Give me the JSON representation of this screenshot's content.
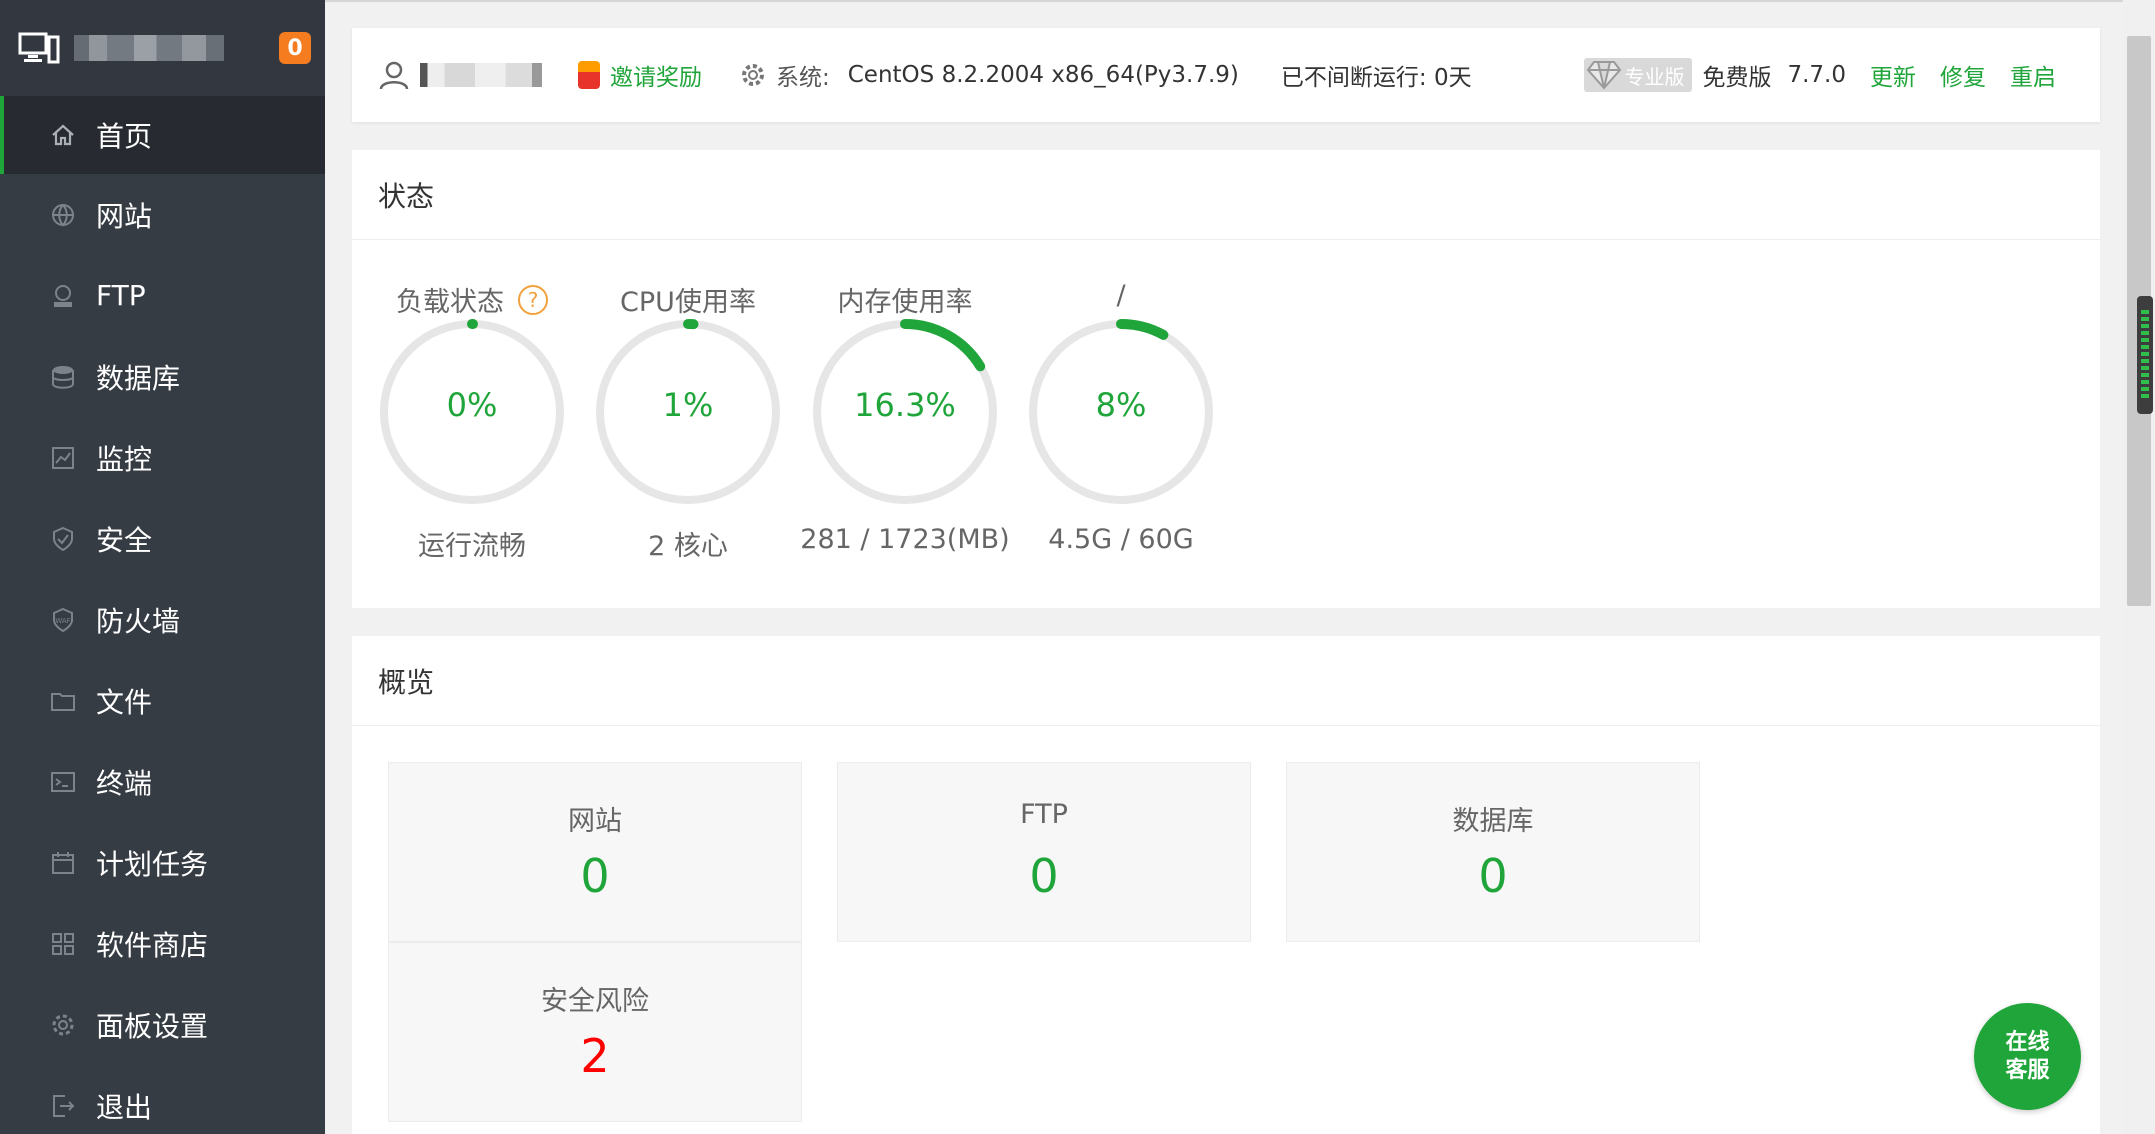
{
  "sidebar": {
    "badge": "0",
    "items": [
      {
        "label": "首页",
        "icon": "home-icon"
      },
      {
        "label": "网站",
        "icon": "globe-icon"
      },
      {
        "label": "FTP",
        "icon": "ftp-icon"
      },
      {
        "label": "数据库",
        "icon": "database-icon"
      },
      {
        "label": "监控",
        "icon": "monitor-icon"
      },
      {
        "label": "安全",
        "icon": "shield-icon"
      },
      {
        "label": "防火墙",
        "icon": "firewall-icon"
      },
      {
        "label": "文件",
        "icon": "folder-icon"
      },
      {
        "label": "终端",
        "icon": "terminal-icon"
      },
      {
        "label": "计划任务",
        "icon": "calendar-icon"
      },
      {
        "label": "软件商店",
        "icon": "grid-icon"
      },
      {
        "label": "面板设置",
        "icon": "settings-icon"
      },
      {
        "label": "退出",
        "icon": "logout-icon"
      }
    ]
  },
  "topbar": {
    "invite": "邀请奖励",
    "sys_label": "系统:",
    "sys_value": "CentOS 8.2.2004 x86_64(Py3.7.9)",
    "uptime": "已不间断运行: 0天",
    "pro": "专业版",
    "free": "免费版",
    "version": "7.7.0",
    "update": "更新",
    "repair": "修复",
    "restart": "重启"
  },
  "status": {
    "title": "状态",
    "gauges": [
      {
        "title": "负载状态",
        "value": "0%",
        "percent": 0,
        "sub": "运行流畅"
      },
      {
        "title": "CPU使用率",
        "value": "1%",
        "percent": 1,
        "sub": "2 核心"
      },
      {
        "title": "内存使用率",
        "value": "16.3%",
        "percent": 16.3,
        "sub": "281 / 1723(MB)"
      },
      {
        "title": "/",
        "value": "8%",
        "percent": 8,
        "sub": "4.5G / 60G"
      }
    ],
    "help": "?"
  },
  "overview": {
    "title": "概览",
    "cards": [
      {
        "label": "网站",
        "value": "0"
      },
      {
        "label": "FTP",
        "value": "0"
      },
      {
        "label": "数据库",
        "value": "0"
      },
      {
        "label": "安全风险",
        "value": "2"
      }
    ]
  },
  "chat": {
    "line1": "在线",
    "line2": "客服"
  },
  "colors": {
    "accent": "#20a53a",
    "danger": "#ff0000",
    "sidebar": "#363c44",
    "badge": "#f57c1f"
  }
}
